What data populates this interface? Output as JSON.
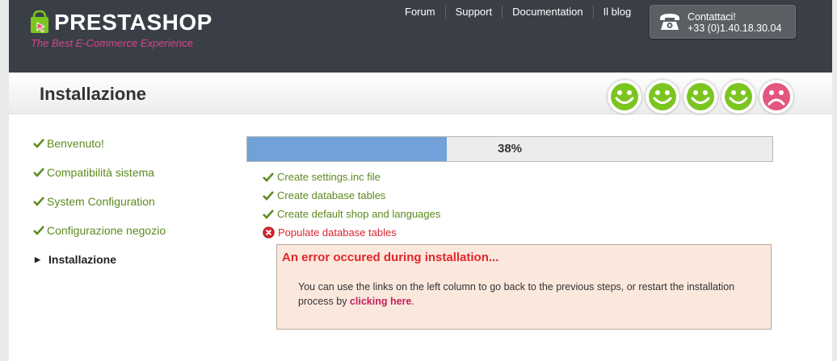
{
  "header": {
    "logo_text": "PRESTASHOP",
    "logo_tagline": "The Best E-Commerce Experience",
    "nav": [
      "Forum",
      "Support",
      "Documentation",
      "Il blog"
    ],
    "contact_label": "Contattaci!",
    "contact_phone": "+33 (0)1.40.18.30.04"
  },
  "page_title": "Installazione",
  "smileys": [
    "happy",
    "happy",
    "happy",
    "happy",
    "sad"
  ],
  "sidebar": {
    "items": [
      {
        "label": "Benvenuto!",
        "state": "done"
      },
      {
        "label": "Compatibilità sistema",
        "state": "done"
      },
      {
        "label": "System Configuration",
        "state": "done"
      },
      {
        "label": "Configurazione negozio",
        "state": "done"
      },
      {
        "label": "Installazione",
        "state": "current"
      }
    ]
  },
  "progress": {
    "percent": 38,
    "label": "38%"
  },
  "steps": [
    {
      "label": "Create settings.inc file",
      "status": "done"
    },
    {
      "label": "Create database tables",
      "status": "done"
    },
    {
      "label": "Create default shop and languages",
      "status": "done"
    },
    {
      "label": "Populate database tables",
      "status": "error"
    }
  ],
  "error": {
    "title": "An error occured during installation...",
    "message_before": "You can use the links on the left column to go back to the previous steps, or restart the installation process by ",
    "link_text": "clicking here",
    "message_after": "."
  },
  "colors": {
    "topbar": "#3a3f47",
    "green": "#5c8a1e",
    "smiley_happy": "#7cc520",
    "smiley_sad": "#e2577f",
    "progress_fill": "#72a0d8",
    "error_red": "#e2262c",
    "error_bg": "#fbe8dd",
    "link_pink": "#c0215e"
  }
}
